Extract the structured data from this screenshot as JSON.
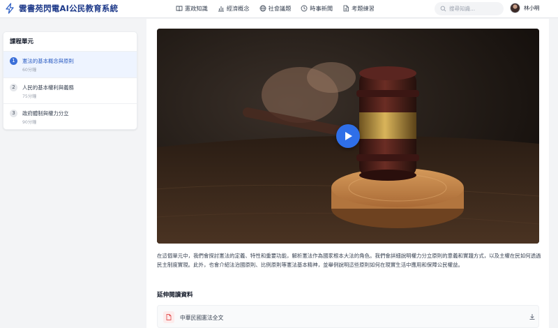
{
  "app": {
    "title": "雲書苑閃電AI公民教育系統",
    "logo_icon": "lightning-icon",
    "accent_color": "#2f6fe8"
  },
  "nav": [
    {
      "label": "憲政知識",
      "icon": "book-icon"
    },
    {
      "label": "經濟概念",
      "icon": "bar-chart-icon"
    },
    {
      "label": "社會議題",
      "icon": "globe-icon"
    },
    {
      "label": "時事新聞",
      "icon": "clock-icon"
    },
    {
      "label": "考題練習",
      "icon": "document-icon"
    }
  ],
  "search": {
    "placeholder": "搜尋知識..."
  },
  "user": {
    "name": "林小明"
  },
  "sidebar": {
    "title": "課程單元",
    "units": [
      {
        "number": "1",
        "title": "憲法的基本概念與原則",
        "duration": "60分鐘",
        "active": true
      },
      {
        "number": "2",
        "title": "人民的基本權利與義務",
        "duration": "75分鐘",
        "active": false
      },
      {
        "number": "3",
        "title": "政府體制與權力分立",
        "duration": "90分鐘",
        "active": false
      }
    ]
  },
  "video": {
    "thumbnail_subject": "judge gavel on sound block",
    "play_icon": "play-icon"
  },
  "main": {
    "description": "在這個單元中，我們會探討憲法的定義、特性和重要功能，解析憲法作為國家根本大法的角色。我們會詳細說明權力分立原則的意義和實踐方式，以及主權在民如何透過民主制度實現。此外，也會介紹法治國原則、比例原則等憲法基本精神，並舉例說明這些原則如何在現實生活中應用和保障公民權益。",
    "reading_title": "延伸閱讀資料",
    "resources": [
      {
        "name": "中華民國憲法全文",
        "icon": "pdf-file-icon",
        "action_icon": "download-icon"
      }
    ]
  }
}
